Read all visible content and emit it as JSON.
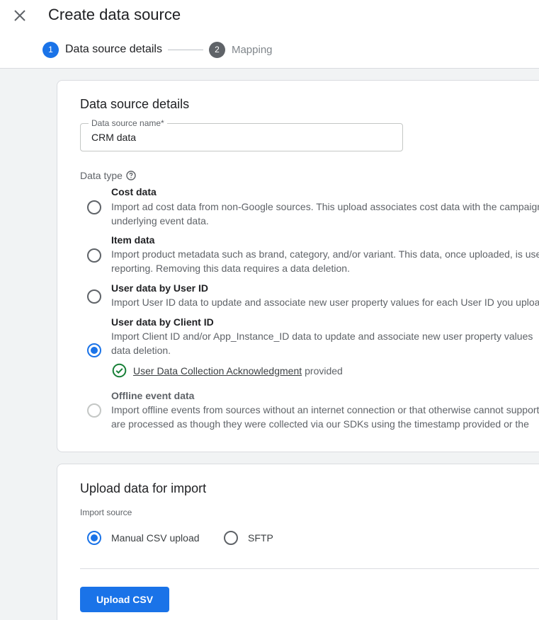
{
  "header": {
    "title": "Create data source",
    "close_icon": "close-icon",
    "steps": [
      {
        "number": "1",
        "label": "Data source details",
        "state": "active"
      },
      {
        "number": "2",
        "label": "Mapping",
        "state": "inactive"
      }
    ]
  },
  "details_card": {
    "title": "Data source details",
    "name_field": {
      "label": "Data source name*",
      "value": "CRM data"
    },
    "data_type_label": "Data type",
    "help_icon": "help-icon",
    "options": [
      {
        "title": "Cost data",
        "description_lines": [
          "Import ad cost data from non-Google sources. This upload associates cost data with the campaign",
          "underlying event data."
        ],
        "selected": false,
        "disabled": false
      },
      {
        "title": "Item data",
        "description_lines": [
          "Import product metadata such as brand, category, and/or variant. This data, once uploaded, is used",
          "reporting. Removing this data requires a data deletion."
        ],
        "selected": false,
        "disabled": false
      },
      {
        "title": "User data by User ID",
        "description_lines": [
          "Import User ID data to update and associate new user property values for each User ID you upload"
        ],
        "selected": false,
        "disabled": false
      },
      {
        "title": "User data by Client ID",
        "description_lines": [
          "Import Client ID and/or App_Instance_ID data to update and associate new user property values",
          "data deletion."
        ],
        "selected": true,
        "disabled": false
      },
      {
        "title": "Offline event data",
        "description_lines": [
          "Import offline events from sources without an internet connection or that otherwise cannot support",
          "are processed as though they were collected via our SDKs using the timestamp provided or the"
        ],
        "selected": false,
        "disabled": true
      }
    ],
    "acknowledgment": {
      "icon": "check-circle-icon",
      "link_text": "User Data Collection Acknowledgment",
      "suffix": "provided",
      "color": "#188038"
    }
  },
  "upload_card": {
    "title": "Upload data for import",
    "import_source_label": "Import source",
    "sources": [
      {
        "label": "Manual CSV upload",
        "selected": true
      },
      {
        "label": "SFTP",
        "selected": false
      }
    ],
    "upload_button": "Upload CSV"
  },
  "colors": {
    "accent": "#1a73e8",
    "success": "#188038"
  }
}
